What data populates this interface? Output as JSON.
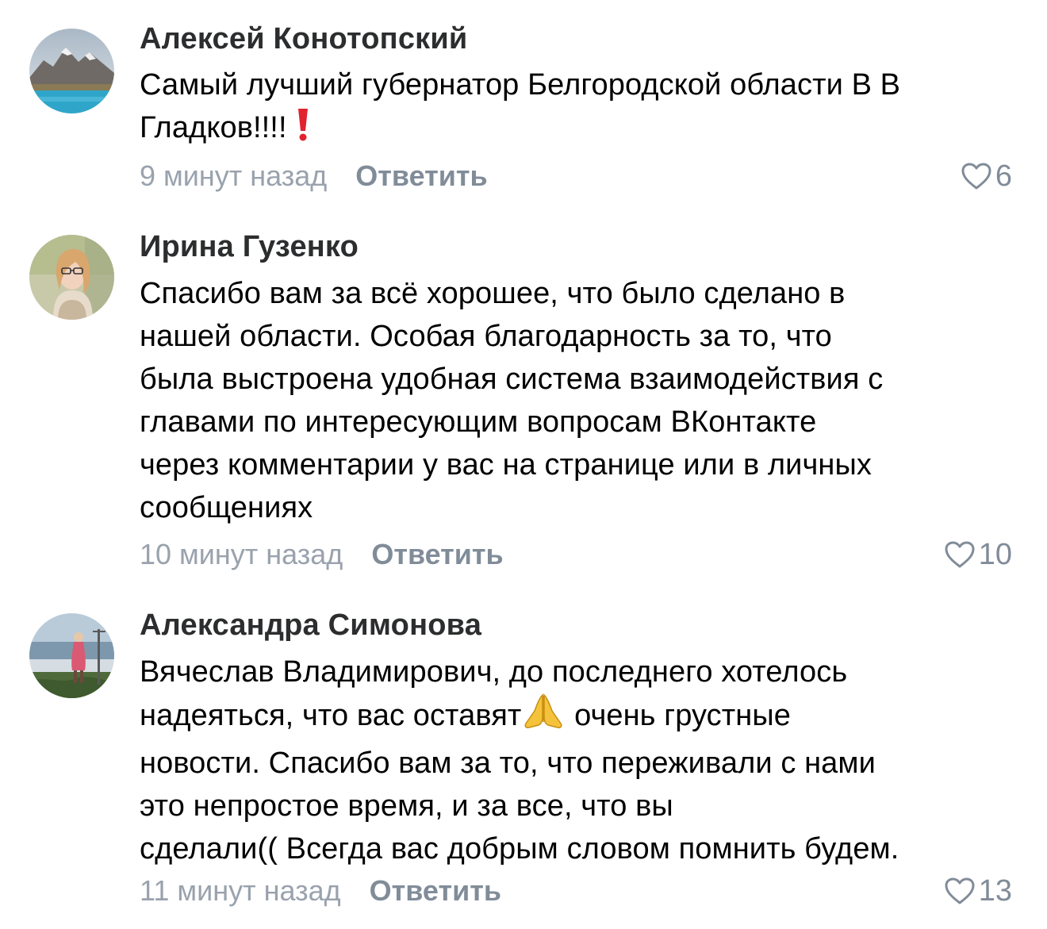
{
  "comments": [
    {
      "author": "Алексей Конотопский",
      "lines": [
        "Самый лучший губернатор Белгородской области В В",
        "Гладков!!!! "
      ],
      "time": "9 минут назад",
      "reply_label": "Ответить",
      "likes": "6"
    },
    {
      "author": "Ирина Гузенко",
      "lines": [
        "Спасибо вам за всё хорошее, что было сделано в",
        "нашей области. Особая благодарность за то, что",
        "была выстроена удобная система взаимодействия с",
        "главами по интересующим вопросам ВКонтакте",
        "через комментарии у вас на странице или в личных",
        "сообщениях"
      ],
      "time": "10 минут назад",
      "reply_label": "Ответить",
      "likes": "10"
    },
    {
      "author": "Александра Симонова",
      "lines": [
        "Вячеслав Владимирович, до последнего хотелось",
        "надеяться, что вас оставят",
        " очень грустные",
        "новости. Спасибо вам за то, что переживали с нами",
        "это непростое время, и за все, что вы",
        "сделали(( Всегда вас добрым словом помнить будем."
      ],
      "time": "11 минут назад",
      "reply_label": "Ответить",
      "likes": "13"
    }
  ],
  "icons": {
    "exclamation": "red-exclamation-icon",
    "pray": "folded-hands-icon",
    "like": "heart-outline-icon"
  },
  "colors": {
    "author": "#2c2d2e",
    "text": "#000000",
    "time": "#99a2ad",
    "action": "#818c99",
    "exclamation": "#e0232e"
  }
}
